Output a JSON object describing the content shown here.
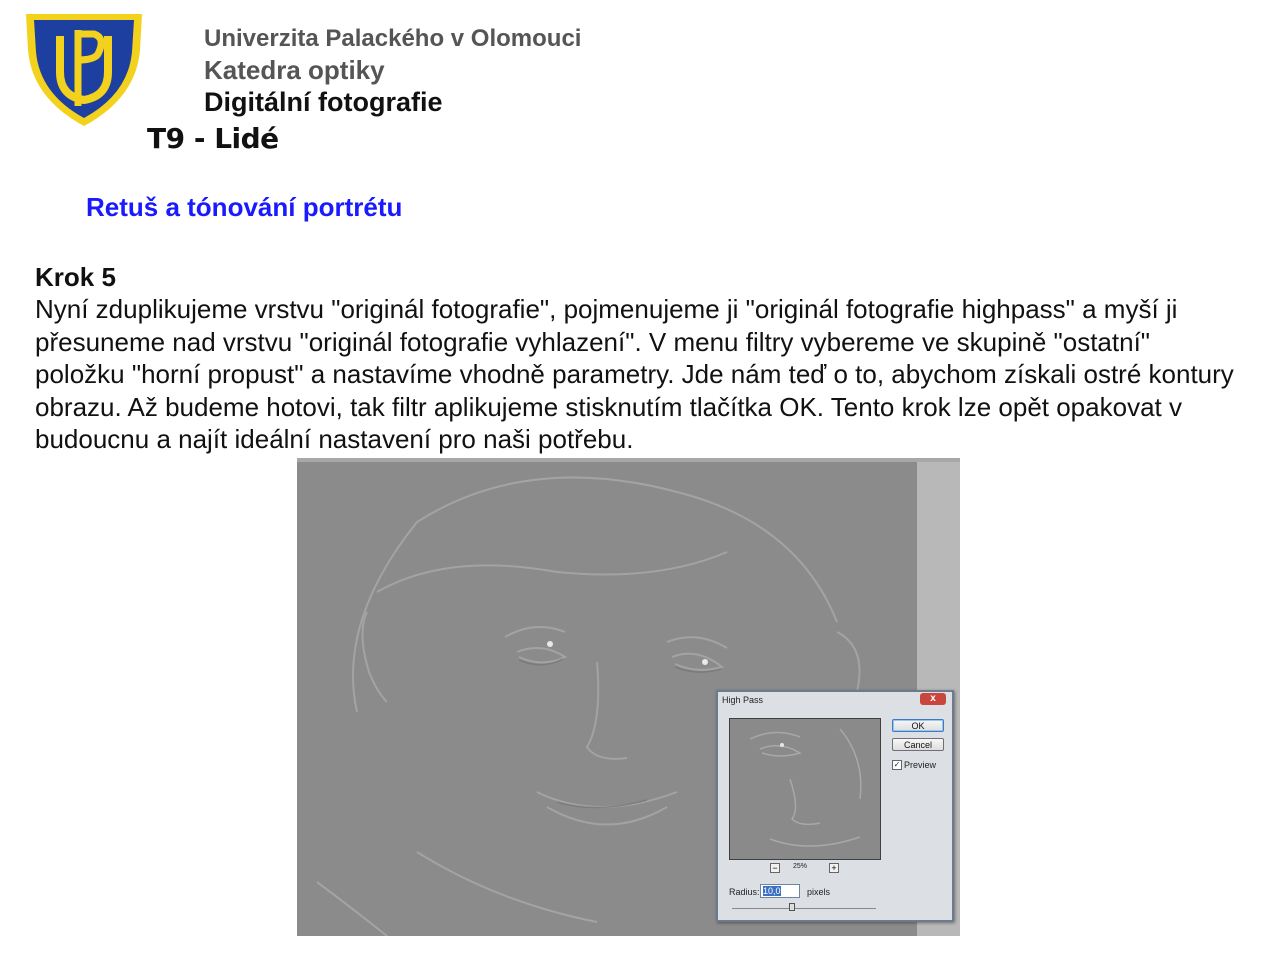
{
  "header": {
    "university": "Univerzita Palackého v Olomouci",
    "department": "Katedra optiky",
    "course": "Digitální fotografie",
    "topic": "T9 - Lidé"
  },
  "section_title": "Retuš a tónování portrétu",
  "step_label": "Krok 5",
  "paragraph": "Nyní zduplikujeme vrstvu \"originál fotografie\", pojmenujeme ji \"originál fotografie highpass\" a myší ji přesuneme nad vrstvu \"originál fotografie vyhlazení\". V menu filtry vybereme ve skupině \"ostatní\" položku \"horní propust\" a nastavíme vhodně parametry. Jde nám teď o to, abychom získali ostré kontury obrazu. Až budeme hotovi, tak filtr aplikujeme stisknutím tlačítka OK. Tento krok lze opět opakovat v budoucnu a najít ideální nastavení pro naši potřebu.",
  "logo": {
    "shield_color": "#1d3fa0",
    "gold_color": "#f2d21c"
  },
  "dialog": {
    "title": "High Pass",
    "close_glyph": "x",
    "ok_label": "OK",
    "cancel_label": "Cancel",
    "preview_checked": true,
    "preview_label": "Preview",
    "zoom_minus": "−",
    "zoom_plus": "+",
    "zoom_value": "25%",
    "radius_label": "Radius:",
    "radius_value": "10,0",
    "radius_unit": "pixels"
  }
}
